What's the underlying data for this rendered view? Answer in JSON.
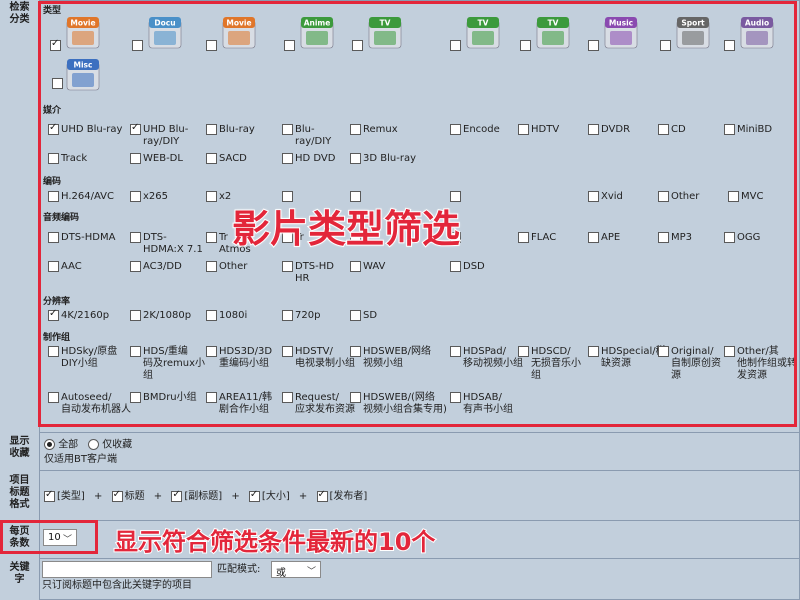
{
  "labels": {
    "search_category": "检索\n分类",
    "display_favorites": "显示\n收藏",
    "title_format": "项目\n标题\n格式",
    "per_page": "每页\n条数",
    "keyword": "关键\n字"
  },
  "sections": {
    "type": "类型",
    "media": "媒介",
    "codec": "编码",
    "audio_codec": "音频编码",
    "resolution": "分辨率",
    "group": "制作组"
  },
  "categories": [
    {
      "label": "Movie",
      "color": "#e0762a",
      "checked": true
    },
    {
      "label": "Docu",
      "color": "#4a90c8",
      "checked": false
    },
    {
      "label": "Movie",
      "color": "#e0762a",
      "checked": false
    },
    {
      "label": "Anime",
      "color": "#3c9a3c",
      "checked": false
    },
    {
      "label": "TV",
      "color": "#3c9a3c",
      "checked": false
    },
    {
      "label": "TV",
      "color": "#3c9a3c",
      "checked": false
    },
    {
      "label": "TV",
      "color": "#3c9a3c",
      "checked": false
    },
    {
      "label": "Music",
      "color": "#8a4ab0",
      "checked": false
    },
    {
      "label": "Sport",
      "color": "#666666",
      "checked": false
    },
    {
      "label": "Audio",
      "color": "#7a5aa0",
      "checked": false
    },
    {
      "label": "Misc",
      "color": "#3c70c0",
      "checked": false
    }
  ],
  "media": [
    {
      "label": "UHD Blu-ray",
      "checked": true
    },
    {
      "label": "UHD Blu-\nray/DIY",
      "checked": true
    },
    {
      "label": "Blu-ray",
      "checked": false
    },
    {
      "label": "Blu-\nray/DIY",
      "checked": false
    },
    {
      "label": "Remux",
      "checked": false
    },
    {
      "label": "Encode",
      "checked": false
    },
    {
      "label": "HDTV",
      "checked": false
    },
    {
      "label": "DVDR",
      "checked": false
    },
    {
      "label": "CD",
      "checked": false
    },
    {
      "label": "MiniBD",
      "checked": false
    },
    {
      "label": "Track",
      "checked": false
    },
    {
      "label": "WEB-DL",
      "checked": false
    },
    {
      "label": "SACD",
      "checked": false
    },
    {
      "label": "HD DVD",
      "checked": false
    },
    {
      "label": "3D Blu-ray",
      "checked": false
    }
  ],
  "codec": [
    {
      "label": "H.264/AVC"
    },
    {
      "label": "x265"
    },
    {
      "label": "x2"
    },
    {
      "label": ""
    },
    {
      "label": ""
    },
    {
      "label": ""
    },
    {
      "label": "Xvid"
    },
    {
      "label": "Other"
    },
    {
      "label": "MVC"
    }
  ],
  "audio": [
    {
      "label": "DTS-HDMA"
    },
    {
      "label": "DTS-\nHDMA:X 7.1"
    },
    {
      "label": "Tr\nAtmos"
    },
    {
      "label": "Tr"
    },
    {
      "label": ""
    },
    {
      "label": ""
    },
    {
      "label": "FLAC"
    },
    {
      "label": "APE"
    },
    {
      "label": "MP3"
    },
    {
      "label": "OGG"
    },
    {
      "label": "AAC"
    },
    {
      "label": "AC3/DD"
    },
    {
      "label": "Other"
    },
    {
      "label": "DTS-HD\nHR"
    },
    {
      "label": "WAV"
    },
    {
      "label": "DSD"
    }
  ],
  "resolution": [
    {
      "label": "4K/2160p",
      "checked": true
    },
    {
      "label": "2K/1080p"
    },
    {
      "label": "1080i"
    },
    {
      "label": "720p"
    },
    {
      "label": "SD"
    }
  ],
  "groups": [
    {
      "label": "HDSky/原盘\nDIY小组"
    },
    {
      "label": "HDS/重编\n码及remux小\n组"
    },
    {
      "label": "HDS3D/3D\n重编码小组"
    },
    {
      "label": "HDSTV/\n电视录制小组"
    },
    {
      "label": "HDSWEB/网络\n视频小组"
    },
    {
      "label": "HDSPad/\n移动视频小组"
    },
    {
      "label": "HDSCD/\n无损音乐小\n组"
    },
    {
      "label": "HDSpecial/稀\n缺资源"
    },
    {
      "label": "Original/\n自制原创资\n源"
    },
    {
      "label": "Other/其\n他制作组或转\n发资源"
    },
    {
      "label": "Autoseed/\n自动发布机器人"
    },
    {
      "label": "BMDru小组"
    },
    {
      "label": "AREA11/韩\n剧合作小组"
    },
    {
      "label": "Request/\n应求发布资源"
    },
    {
      "label": "HDSWEB/(网络\n视频小组合集专用)"
    },
    {
      "label": "HDSAB/\n有声书小组"
    }
  ],
  "overlay": {
    "main": "影片类型筛选",
    "per_page_note": "显示符合筛选条件最新的10个"
  },
  "favorites": {
    "all": "全部",
    "only": "仅收藏",
    "note": "仅适用BT客户端"
  },
  "title_format": {
    "type": "[类型]",
    "title": "标题",
    "subtitle": "[副标题]",
    "size": "[大小]",
    "publisher": "[发布者]",
    "plus": "+"
  },
  "per_page": {
    "value": "10"
  },
  "keyword": {
    "match_label": "匹配模式:",
    "match_value": "或",
    "note": "只订阅标题中包含此关键字的项目"
  },
  "colors": {
    "accent_red": "#e3263a",
    "bg": "#c2cfdc"
  }
}
